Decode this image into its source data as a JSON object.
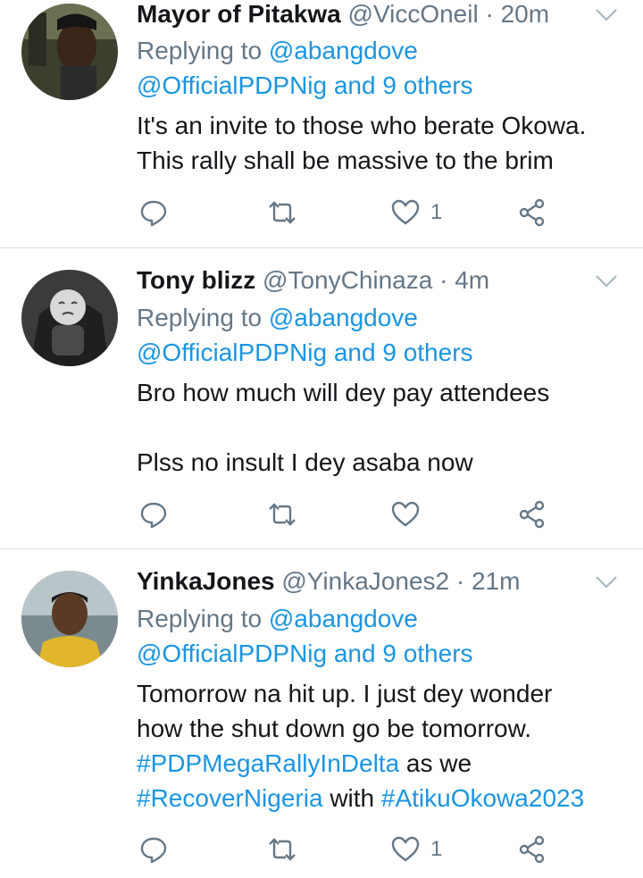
{
  "tweets": [
    {
      "name": "Mayor of Pitakwa",
      "handle": "@ViccOneil",
      "time": "· 20m",
      "replying_prefix": "Replying to",
      "replying_user": "@abangdove",
      "replying_line2": "@OfficialPDPNig and 9 others",
      "text_lines": [
        "It's an invite to those who berate Okowa.",
        "This rally shall be massive to the brim"
      ],
      "like_count": "1",
      "avatar_bg": "#3a3f2e"
    },
    {
      "name": "Tony blizz",
      "handle": "@TonyChinaza",
      "time": "· 4m",
      "replying_prefix": "Replying to",
      "replying_user": "@abangdove",
      "replying_line2": "@OfficialPDPNig and 9 others",
      "text_lines": [
        "Bro how much will dey pay attendees",
        "Plss no insult I dey asaba now"
      ],
      "like_count": "",
      "avatar_bg": "#3b3b3b"
    },
    {
      "name": "YinkaJones",
      "handle": "@YinkaJones2",
      "time": "· 21m",
      "replying_prefix": "Replying to",
      "replying_user": "@abangdove",
      "replying_line2": "@OfficialPDPNig and 9 others",
      "text_line1": "Tomorrow na hit up. I just dey wonder",
      "text_line2": "how the shut down go be tomorrow.",
      "hashtag1": "#PDPMegaRallyInDelta",
      "text_as_we": " as we",
      "hashtag2": "#RecoverNigeria",
      "text_with": " with ",
      "hashtag3": "#AtikuOkowa2023",
      "like_count": "1",
      "avatar_bg": "#7a8a8f"
    }
  ],
  "colors": {
    "link": "#1b95e0",
    "muted": "#657786",
    "text": "#14171a",
    "divider": "#dfe3e8"
  },
  "icons": [
    "reply-icon",
    "retweet-icon",
    "like-icon",
    "share-icon",
    "chevron-down-icon"
  ]
}
